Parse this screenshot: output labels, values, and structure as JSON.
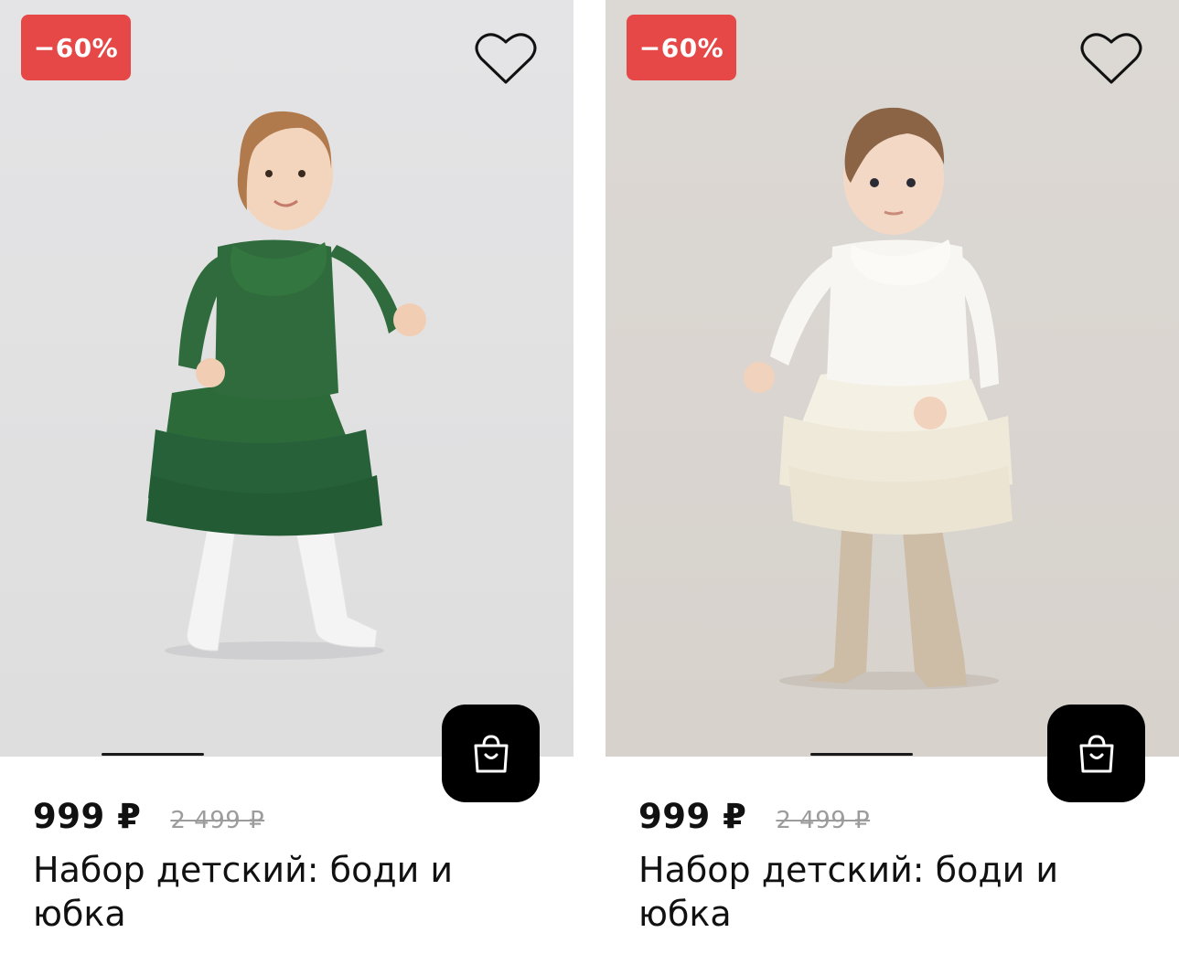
{
  "products": [
    {
      "discount_badge": "−60%",
      "price": "999 ₽",
      "old_price": "2 499 ₽",
      "title": "Набор детский: боди и юбка",
      "badge_color": "#e64848",
      "outfit_color": "#2f6b3c",
      "icons": {
        "favorite": "heart-outline-icon",
        "cart": "shopping-bag-icon"
      }
    },
    {
      "discount_badge": "−60%",
      "price": "999 ₽",
      "old_price": "2 499 ₽",
      "title": "Набор детский: боди и юбка",
      "badge_color": "#e64848",
      "outfit_color": "#f6f3ea",
      "icons": {
        "favorite": "heart-outline-icon",
        "cart": "shopping-bag-icon"
      }
    }
  ]
}
